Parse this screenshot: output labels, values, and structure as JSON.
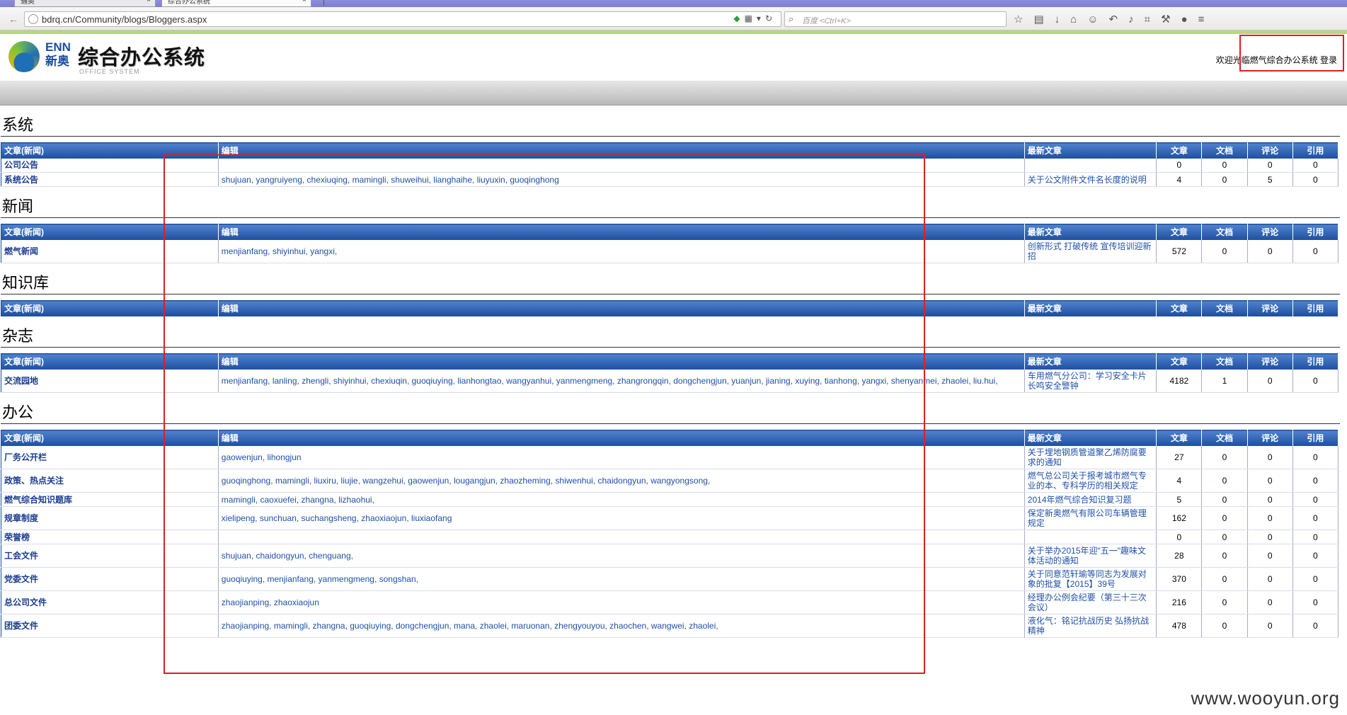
{
  "browser": {
    "tabs": [
      {
        "label": "通奥"
      },
      {
        "label": "综合办公系统"
      }
    ],
    "url": "bdrq.cn/Community/blogs/Bloggers.aspx",
    "search_placeholder": "百度 <Ctrl+K>"
  },
  "header": {
    "logo_enn": "ENN",
    "logo_xinao": "新奥",
    "title": "综合办公系统",
    "subtitle": "OFFICE SYSTEM",
    "welcome": "欢迎光临燃气综合办公系统",
    "login": "登录"
  },
  "columns": {
    "category": "文章(新闻)",
    "editors": "编辑",
    "latest": "最新文章",
    "articles": "文章",
    "docs": "文档",
    "comments": "评论",
    "refs": "引用"
  },
  "sections": [
    {
      "title": "系统",
      "rows": [
        {
          "category": "公司公告",
          "editors": "",
          "latest": "",
          "articles": "0",
          "docs": "0",
          "comments": "0",
          "refs": "0"
        },
        {
          "category": "系统公告",
          "editors": "shujuan, yangruiyeng, chexiuqing, mamingli, shuweihui, lianghaihe, liuyuxin, guoqinghong",
          "latest": "关于公文附件文件名长度的说明",
          "articles": "4",
          "docs": "0",
          "comments": "5",
          "refs": "0"
        }
      ]
    },
    {
      "title": "新闻",
      "rows": [
        {
          "category": "燃气新闻",
          "editors": "menjianfang, shiyinhui, yangxi,",
          "latest": "创新形式 打破传统 宣传培训迎新招",
          "articles": "572",
          "docs": "0",
          "comments": "0",
          "refs": "0"
        }
      ]
    },
    {
      "title": "知识库",
      "rows": []
    },
    {
      "title": "杂志",
      "rows": [
        {
          "category": "交流园地",
          "editors": "menjianfang, lanling, zhengli, shiyinhui, chexiuqin, guoqiuying, lianhongtao, wangyanhui, yanmengmeng, zhangrongqin, dongchengjun, yuanjun, jianing, xuying, tianhong, yangxi, shenyanmei, zhaolei, liu.hui,",
          "latest": "车用燃气分公司：学习安全卡片 长鸣安全警钟",
          "articles": "4182",
          "docs": "1",
          "comments": "0",
          "refs": "0"
        }
      ]
    },
    {
      "title": "办公",
      "rows": [
        {
          "category": "厂务公开栏",
          "editors": "gaowenjun, lihongjun",
          "latest": "关于埋地钢质管道聚乙烯防腐要求的通知",
          "articles": "27",
          "docs": "0",
          "comments": "0",
          "refs": "0"
        },
        {
          "category": "政策、热点关注",
          "editors": "guoqinghong, mamingli, liuxiru, liujie, wangzehui, gaowenjun, lougangjun, zhaozheming, shiwenhui, chaidongyun, wangyongsong,",
          "latest": "燃气总公司关于报考城市燃气专业的本、专科学历的相关规定",
          "articles": "4",
          "docs": "0",
          "comments": "0",
          "refs": "0"
        },
        {
          "category": "燃气综合知识题库",
          "editors": "mamingli, caoxuefei, zhangna, lizhaohui,",
          "latest": "2014年燃气综合知识复习题",
          "articles": "5",
          "docs": "0",
          "comments": "0",
          "refs": "0"
        },
        {
          "category": "规章制度",
          "editors": "xielipeng, sunchuan, suchangsheng, zhaoxiaojun, liuxiaofang",
          "latest": "保定新奥燃气有限公司车辆管理规定",
          "articles": "162",
          "docs": "0",
          "comments": "0",
          "refs": "0"
        },
        {
          "category": "荣誉榜",
          "editors": "",
          "latest": "",
          "articles": "0",
          "docs": "0",
          "comments": "0",
          "refs": "0"
        },
        {
          "category": "工会文件",
          "editors": "shujuan, chaidongyun, chenguang,",
          "latest": "关于举办2015年迎\"五一\"趣味文体活动的通知",
          "articles": "28",
          "docs": "0",
          "comments": "0",
          "refs": "0"
        },
        {
          "category": "党委文件",
          "editors": "guoqiuying, menjianfang, yanmengmeng, songshan,",
          "latest": "关于同意范轩瑜等同志为发展对象的批复【2015】39号",
          "articles": "370",
          "docs": "0",
          "comments": "0",
          "refs": "0"
        },
        {
          "category": "总公司文件",
          "editors": "zhaojianping, zhaoxiaojun",
          "latest": "经理办公例会纪要（第三十三次会议）",
          "articles": "216",
          "docs": "0",
          "comments": "0",
          "refs": "0"
        },
        {
          "category": "团委文件",
          "editors": "zhaojianping, mamingli, zhangna, guoqiuying, dongchengjun, mana, zhaolei, maruonan, zhengyouyou, zhaochen, wangwei, zhaolei,",
          "latest": "液化气：铭记抗战历史 弘扬抗战精神",
          "articles": "478",
          "docs": "0",
          "comments": "0",
          "refs": "0"
        }
      ]
    }
  ],
  "watermark": "www.wooyun.org"
}
